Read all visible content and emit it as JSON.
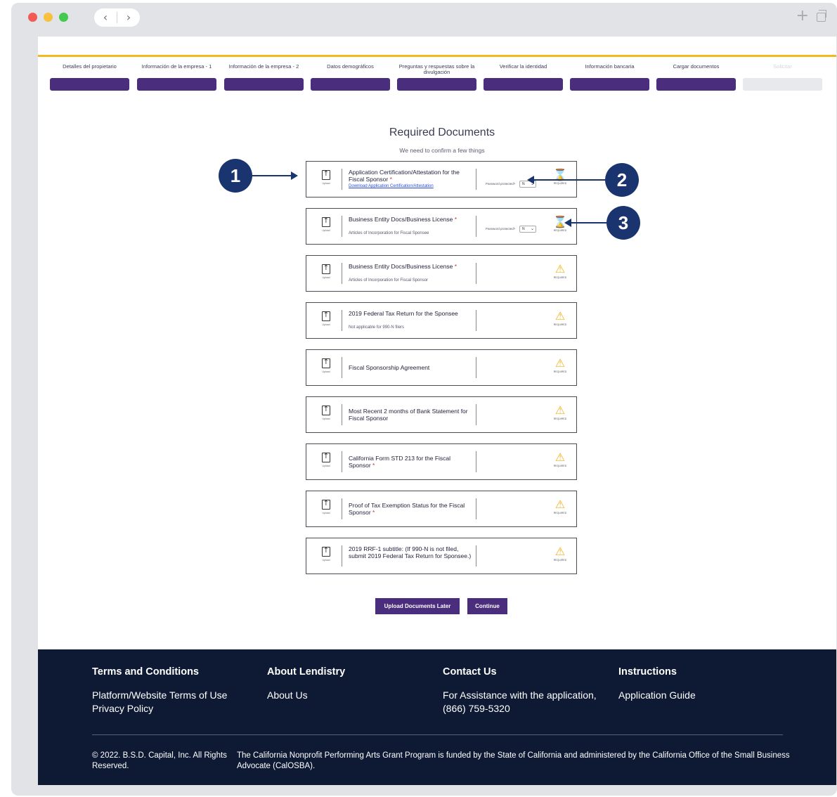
{
  "steps": [
    {
      "label": "Detalles del propietario",
      "state": "done"
    },
    {
      "label": "Información de la empresa - 1",
      "state": "done"
    },
    {
      "label": "Información de la empresa - 2",
      "state": "done"
    },
    {
      "label": "Datos demográficos",
      "state": "done"
    },
    {
      "label": "Preguntas y respuestas sobre la divulgación",
      "state": "done"
    },
    {
      "label": "Verificar la identidad",
      "state": "done"
    },
    {
      "label": "Información bancaria",
      "state": "done"
    },
    {
      "label": "Cargar documentos",
      "state": "done"
    },
    {
      "label": "Solicitar",
      "state": "pending"
    }
  ],
  "main": {
    "title": "Required Documents",
    "subtitle": "We need to confirm a few things",
    "upload_icon_caption": "Upload",
    "password_label": "Password protected?",
    "password_value": "N",
    "status_caption": "REQUIRED",
    "documents": [
      {
        "title": "Application Certification/Attestation for the Fiscal Sponsor",
        "required": "*",
        "link": "Download Application Certification/Attestation",
        "password": true,
        "status": "pending"
      },
      {
        "title": "Business Entity Docs/Business License",
        "required": "*",
        "sub": "Articles of Incorporation for Fiscal Sponsee",
        "password": true,
        "status": "pending"
      },
      {
        "title": "Business Entity Docs/Business License",
        "required": "*",
        "sub": "Articles of Incorporation for Fiscal Sponsor",
        "status": "warning"
      },
      {
        "title": "2019 Federal Tax Return for the Sponsee",
        "sub": "Not applicable for 990-N filers",
        "status": "warning"
      },
      {
        "title": "Fiscal Sponsorship Agreement",
        "status": "warning"
      },
      {
        "title": "Most Recent 2 months of Bank Statement for Fiscal Sponsor",
        "status": "warning"
      },
      {
        "title": "California Form STD 213 for the Fiscal Sponsor",
        "required": "*",
        "status": "warning"
      },
      {
        "title": "Proof of Tax Exemption Status for the Fiscal Sponsor",
        "required": "*",
        "status": "warning"
      },
      {
        "title": "2019 RRF-1 subtitle: (If 990-N is not filed, submit 2019 Federal Tax Return for Sponsee.)",
        "status": "warning"
      }
    ],
    "buttons": {
      "later": "Upload Documents Later",
      "continue": "Continue"
    }
  },
  "callouts": [
    "1",
    "2",
    "3"
  ],
  "footer": {
    "cols": [
      {
        "heading": "Terms and Conditions",
        "links": [
          "Platform/Website Terms of Use",
          "Privacy Policy"
        ]
      },
      {
        "heading": "About Lendistry",
        "links": [
          "About Us"
        ]
      },
      {
        "heading": "Contact Us",
        "links": [
          "For Assistance with the application, (866) 759-5320"
        ]
      },
      {
        "heading": "Instructions",
        "links": [
          "Application Guide"
        ]
      }
    ],
    "copyright": "© 2022. B.S.D. Capital, Inc. All Rights Reserved.",
    "note": "The California Nonprofit Performing Arts Grant Program is funded by the State of California and administered by the California Office of the Small Business Advocate (CalOSBA)."
  },
  "colors": {
    "accent": "#4a2d7c",
    "progress_line": "#f2b81e",
    "footer_bg": "#0e1a33",
    "callout": "#1a3470",
    "status_icon": "#f0b31a"
  }
}
